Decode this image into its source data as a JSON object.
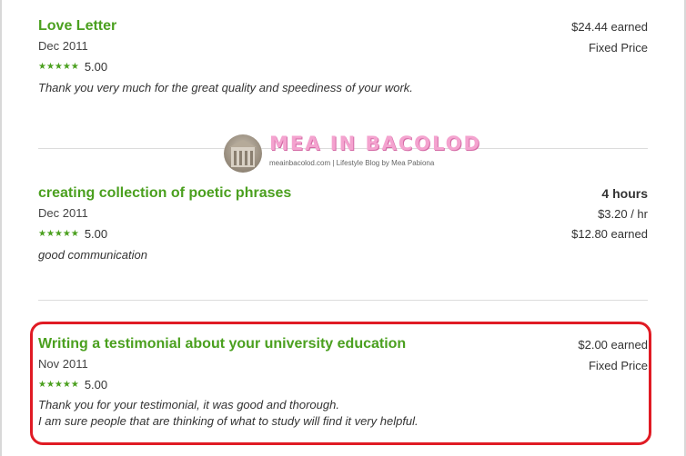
{
  "jobs": [
    {
      "title": "Love Letter",
      "date": "Dec 2011",
      "stars": "★★★★★",
      "rating": "5.00",
      "feedback": "Thank you very much for the great quality and speediness of your work.",
      "earned": "$24.44 earned",
      "price_type": "Fixed Price"
    },
    {
      "title": "creating collection of poetic phrases",
      "date": "Dec 2011",
      "stars": "★★★★★",
      "rating": "5.00",
      "feedback": "good communication",
      "hours": "4 hours",
      "rate": "$3.20 / hr",
      "earned": "$12.80 earned"
    },
    {
      "title": "Writing a testimonial about your university education",
      "date": "Nov 2011",
      "stars": "★★★★★",
      "rating": "5.00",
      "feedback_line1": "Thank you for your testimonial, it was good and thorough.",
      "feedback_line2": "I am sure people that are thinking of what to study will find it very helpful.",
      "earned": "$2.00 earned",
      "price_type": "Fixed Price"
    }
  ],
  "watermark": {
    "title": "MEA IN BACOLOD",
    "subtitle": "meainbacolod.com | Lifestyle Blog by Mea Pabiona"
  },
  "colors": {
    "accent_green": "#4ba01f",
    "highlight_red": "#e01b24",
    "watermark_pink": "#f4a3cf"
  }
}
